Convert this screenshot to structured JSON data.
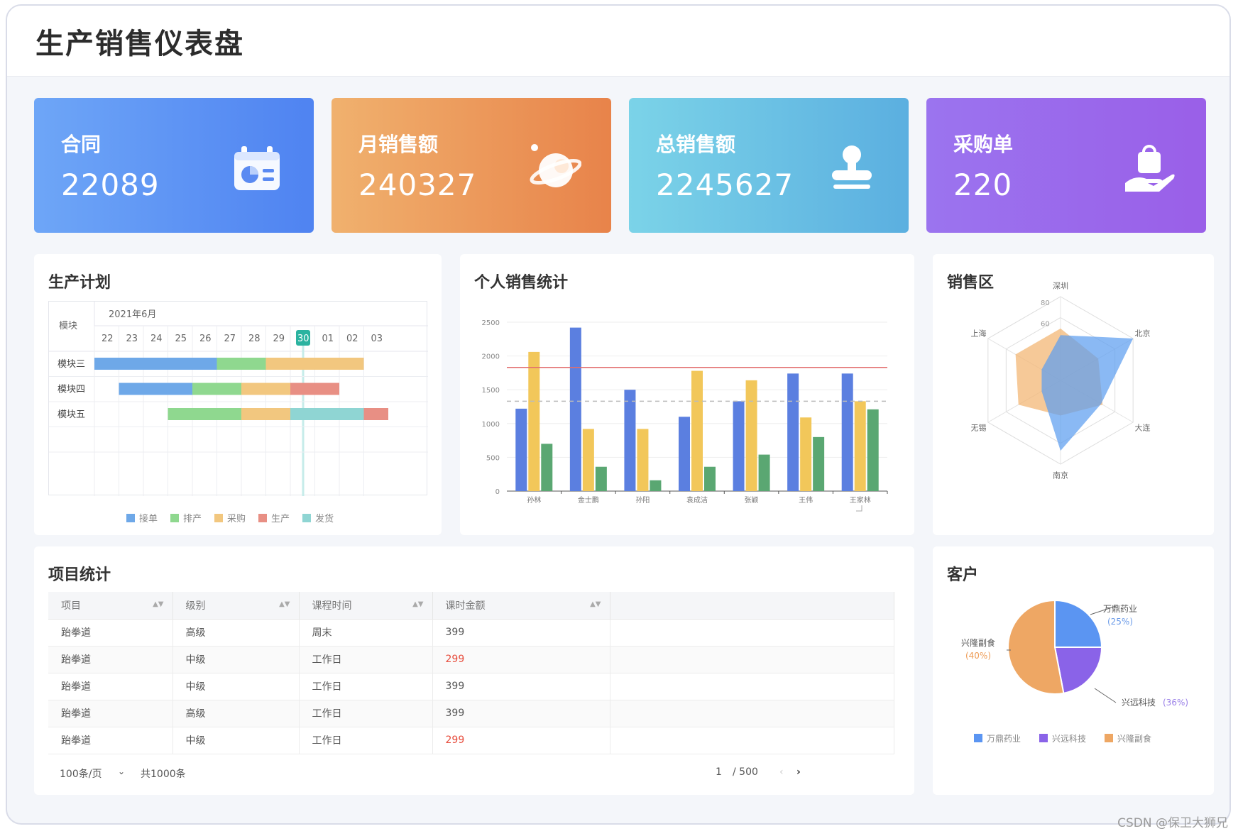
{
  "title": "生产销售仪表盘",
  "stats": [
    {
      "label": "合同",
      "value": "22089",
      "icon": "calendar-chart-icon"
    },
    {
      "label": "月销售额",
      "value": "240327",
      "icon": "planet-icon"
    },
    {
      "label": "总销售额",
      "value": "2245627",
      "icon": "stamp-icon"
    },
    {
      "label": "采购单",
      "value": "220",
      "icon": "hand-bag-icon"
    }
  ],
  "gantt": {
    "title": "生产计划",
    "module_header": "模块",
    "month": "2021年6月",
    "days": [
      "22",
      "23",
      "24",
      "25",
      "26",
      "27",
      "28",
      "29",
      "30",
      "01",
      "02",
      "03"
    ],
    "today": "30",
    "rows": [
      "模块三",
      "模块四",
      "模块五"
    ],
    "tasks": [
      {
        "row": 0,
        "type": "接单",
        "start": 0,
        "end": 5
      },
      {
        "row": 0,
        "type": "排产",
        "start": 5,
        "end": 7
      },
      {
        "row": 0,
        "type": "采购",
        "start": 7,
        "end": 11
      },
      {
        "row": 1,
        "type": "接单",
        "start": 1,
        "end": 4
      },
      {
        "row": 1,
        "type": "排产",
        "start": 4,
        "end": 6
      },
      {
        "row": 1,
        "type": "采购",
        "start": 6,
        "end": 8
      },
      {
        "row": 1,
        "type": "生产",
        "start": 8,
        "end": 10
      },
      {
        "row": 2,
        "type": "排产",
        "start": 3,
        "end": 6
      },
      {
        "row": 2,
        "type": "采购",
        "start": 6,
        "end": 8
      },
      {
        "row": 2,
        "type": "发货",
        "start": 8,
        "end": 11
      },
      {
        "row": 2,
        "type": "生产",
        "start": 11,
        "end": 12
      }
    ],
    "legend": [
      {
        "label": "接单",
        "color": "#6ea8e8"
      },
      {
        "label": "排产",
        "color": "#8fd88f"
      },
      {
        "label": "采购",
        "color": "#f2c77f"
      },
      {
        "label": "生产",
        "color": "#e88f84"
      },
      {
        "label": "发货",
        "color": "#8fd5d3"
      }
    ]
  },
  "chart_data": [
    {
      "type": "bar",
      "title": "个人销售统计",
      "categories": [
        "孙林",
        "金士鹏",
        "孙阳",
        "袁成洁",
        "张颖",
        "王伟",
        "王家林"
      ],
      "series": [
        {
          "values": [
            1220,
            2420,
            1500,
            1100,
            1330,
            1740,
            1740
          ],
          "color": "#5b7fe0"
        },
        {
          "values": [
            2060,
            920,
            920,
            1780,
            1640,
            1090,
            1330
          ],
          "color": "#f2c75a"
        },
        {
          "values": [
            700,
            360,
            160,
            360,
            540,
            800,
            1210
          ],
          "color": "#5aa772"
        }
      ],
      "ylim": [
        0,
        2500
      ],
      "yticks": [
        "0",
        "500",
        "1000",
        "1500",
        "2000",
        "2500"
      ],
      "reference_lines": [
        {
          "value": 1830,
          "style": "solid",
          "color": "#e26d6d"
        },
        {
          "value": 1330,
          "style": "dashed",
          "color": "#bbbbbb"
        }
      ]
    },
    {
      "type": "radar",
      "title": "销售区",
      "axes": [
        "深圳",
        "北京",
        "大连",
        "南京",
        "无锡",
        "上海"
      ],
      "rings": [
        "80",
        "60"
      ],
      "max": 100,
      "series": [
        {
          "values": [
            62,
            52,
            58,
            42,
            58,
            62
          ],
          "color": "#f2b470"
        },
        {
          "values": [
            54,
            100,
            56,
            84,
            26,
            26
          ],
          "color": "#5d9ef0"
        }
      ]
    },
    {
      "type": "pie",
      "title": "客户",
      "slices": [
        {
          "label": "万鼎药业",
          "pct_label": "(25%)",
          "value": 25,
          "color": "#5b95f2",
          "label_color": "#6b9be8"
        },
        {
          "label": "兴远科技",
          "pct_label": "(36%)",
          "value": 22,
          "color": "#8a63e8",
          "label_color": "#9a80e8"
        },
        {
          "label": "兴隆副食",
          "pct_label": "(40%)",
          "value": 53,
          "color": "#eea764",
          "label_color": "#ee9c55"
        }
      ],
      "legend": [
        "万鼎药业",
        "兴远科技",
        "兴隆副食"
      ]
    }
  ],
  "table": {
    "title": "项目统计",
    "headers": [
      "项目",
      "级别",
      "课程时间",
      "课时金额"
    ],
    "rows": [
      [
        "跆拳道",
        "高级",
        "周末",
        "399"
      ],
      [
        "跆拳道",
        "中级",
        "工作日",
        "299"
      ],
      [
        "跆拳道",
        "中级",
        "工作日",
        "399"
      ],
      [
        "跆拳道",
        "高级",
        "工作日",
        "399"
      ],
      [
        "跆拳道",
        "中级",
        "工作日",
        "299"
      ]
    ],
    "page_size": "100条/页",
    "total": "共1000条",
    "page_current": "1",
    "page_total": "/ 500"
  },
  "watermark": "CSDN @保卫大狮兄"
}
